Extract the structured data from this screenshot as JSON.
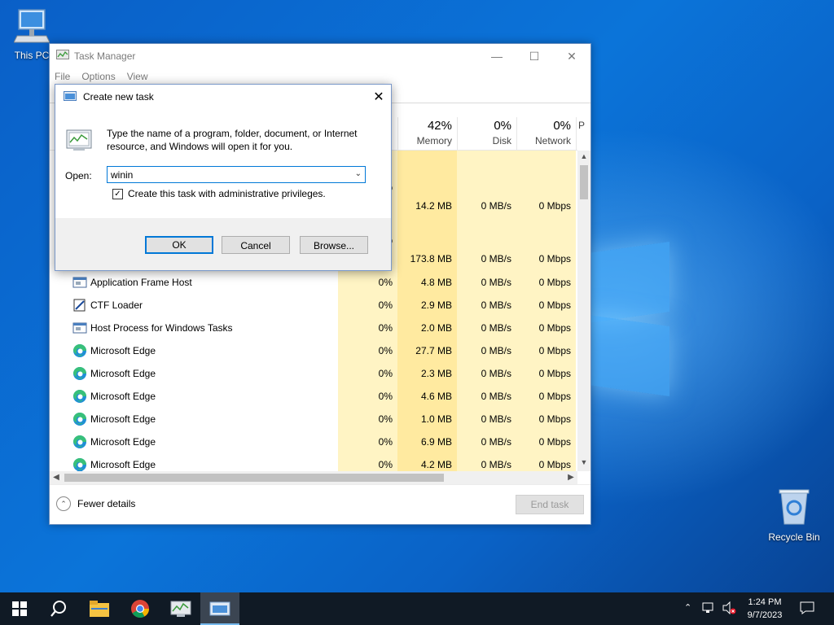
{
  "desktop": {
    "icons": [
      {
        "label": "This PC"
      },
      {
        "label": "Recycle Bin"
      }
    ]
  },
  "task_manager": {
    "title": "Task Manager",
    "menu": [
      "File",
      "Options",
      "View"
    ],
    "columns": [
      {
        "pct": "42%",
        "label": "Memory"
      },
      {
        "pct": "0%",
        "label": "Disk"
      },
      {
        "pct": "0%",
        "label": "Network"
      },
      {
        "pct": "",
        "label": "P"
      }
    ],
    "partial_cells": [
      "%",
      "%"
    ],
    "rows": [
      {
        "name": "",
        "cpu": "",
        "memory": "14.2 MB",
        "disk": "0 MB/s",
        "network": "0 Mbps"
      },
      {
        "name": "",
        "cpu": "",
        "memory": "173.8 MB",
        "disk": "0 MB/s",
        "network": "0 Mbps"
      },
      {
        "name": "Application Frame Host",
        "cpu": "0%",
        "memory": "4.8 MB",
        "disk": "0 MB/s",
        "network": "0 Mbps",
        "icon": "frame-icon"
      },
      {
        "name": "CTF Loader",
        "cpu": "0%",
        "memory": "2.9 MB",
        "disk": "0 MB/s",
        "network": "0 Mbps",
        "icon": "ctf-icon"
      },
      {
        "name": "Host Process for Windows Tasks",
        "cpu": "0%",
        "memory": "2.0 MB",
        "disk": "0 MB/s",
        "network": "0 Mbps",
        "icon": "host-icon"
      },
      {
        "name": "Microsoft Edge",
        "cpu": "0%",
        "memory": "27.7 MB",
        "disk": "0 MB/s",
        "network": "0 Mbps",
        "icon": "edge-icon"
      },
      {
        "name": "Microsoft Edge",
        "cpu": "0%",
        "memory": "2.3 MB",
        "disk": "0 MB/s",
        "network": "0 Mbps",
        "icon": "edge-icon"
      },
      {
        "name": "Microsoft Edge",
        "cpu": "0%",
        "memory": "4.6 MB",
        "disk": "0 MB/s",
        "network": "0 Mbps",
        "icon": "edge-icon"
      },
      {
        "name": "Microsoft Edge",
        "cpu": "0%",
        "memory": "1.0 MB",
        "disk": "0 MB/s",
        "network": "0 Mbps",
        "icon": "edge-icon"
      },
      {
        "name": "Microsoft Edge",
        "cpu": "0%",
        "memory": "6.9 MB",
        "disk": "0 MB/s",
        "network": "0 Mbps",
        "icon": "edge-icon"
      },
      {
        "name": "Microsoft Edge",
        "cpu": "0%",
        "memory": "4.2 MB",
        "disk": "0 MB/s",
        "network": "0 Mbps",
        "icon": "edge-icon"
      }
    ],
    "fewer_details": "Fewer details",
    "end_task": "End task"
  },
  "dialog": {
    "title": "Create new task",
    "message": "Type the name of a program, folder, document, or Internet resource, and Windows will open it for you.",
    "open_label": "Open:",
    "open_value": "winin",
    "admin_checkbox": "Create this task with administrative privileges.",
    "admin_checked": true,
    "ok": "OK",
    "cancel": "Cancel",
    "browse": "Browse..."
  },
  "taskbar": {
    "time": "1:24 PM",
    "date": "9/7/2023"
  },
  "colors": {
    "accent": "#0078d7",
    "memory_band": "#fff4c4",
    "memory_band_strong": "#ffeaa0"
  }
}
